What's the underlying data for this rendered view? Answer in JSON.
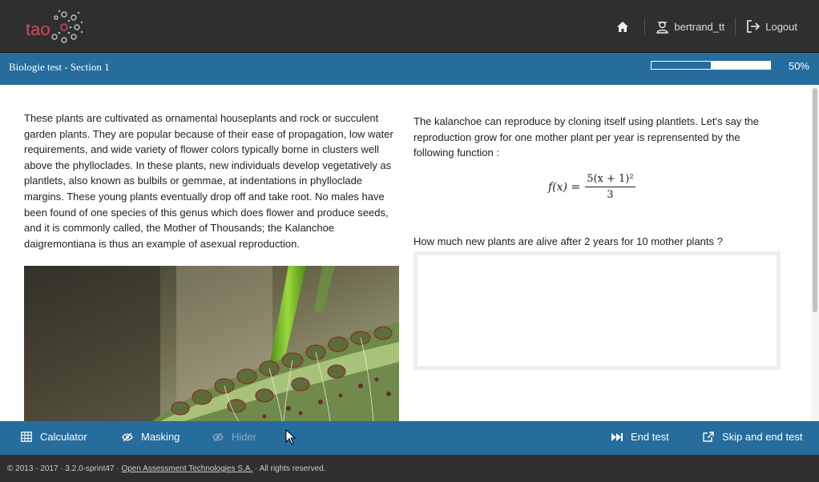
{
  "header": {
    "logo_text": "tao",
    "username": "bertrand_tt",
    "logout_label": "Logout"
  },
  "titlebar": {
    "title": "Biologie test - Section 1",
    "progress_fraction": 0.5,
    "progress_label": "50%"
  },
  "passage": {
    "text": "These plants are cultivated as ornamental houseplants and rock or succulent garden plants. They are popular because of their ease of propagation, low water requirements, and wide variety of flower colors typically borne in clusters well above the phylloclades. In these plants, new individuals develop vegetatively as plantlets, also known as bulbils or gemmae, at indentations in phylloclade margins. These young plants eventually drop off and take root. No males have been found of one species of this genus which does flower and produce seeds, and it is commonly called, the Mother of Thousands; the Kalanchoe daigremontiana is thus an example of asexual reproduction."
  },
  "item": {
    "prompt": "The kalanchoe can reproduce by cloning itself using plantlets.  Let's say the reproduction grow for one mother plant per year is reprensented by the following function :",
    "formula_lhs": "f(x) =",
    "formula_numerator": "5(x + 1)²",
    "formula_denominator": "3",
    "question": "How much new plants are alive after 2 years for 10 mother plants ?",
    "answer_value": ""
  },
  "toolbar": {
    "calculator_label": "Calculator",
    "masking_label": "Masking",
    "hider_label": "Hider",
    "end_test_label": "End test",
    "skip_end_label": "Skip and end test"
  },
  "footer": {
    "prefix": "© 2013 - 2017 · 3.2.0-sprint47 · ",
    "link": "Open Assessment Technologies S.A.",
    "suffix": " · All rights reserved."
  },
  "colors": {
    "brand_blue": "#266c9d",
    "dark_bar": "#2f2f2f",
    "logo_red": "#d04b5a"
  }
}
